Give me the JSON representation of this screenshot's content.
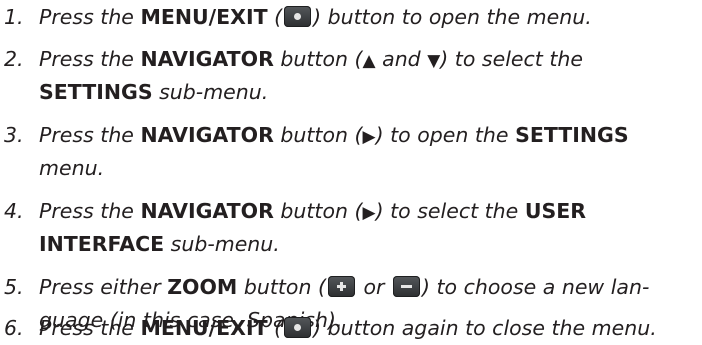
{
  "steps": [
    {
      "num": "1.",
      "t1": "Press the ",
      "b1": "MENU/EXIT",
      "t2": " (",
      "icon": "menu-exit-button-icon",
      "t3": ") button to open the menu."
    },
    {
      "num": "2.",
      "t1": "Press the ",
      "b1": "NAVIGATOR",
      "t2": " button (",
      "g1": "▲",
      "t3": " and ",
      "g2": "▼",
      "t4": ") to select the",
      "b2": "SETTINGS",
      "t5": " sub-menu."
    },
    {
      "num": "3.",
      "t1": "Press the ",
      "b1": "NAVIGATOR",
      "t2": " button (",
      "g1": "▶",
      "t3": ") to open the ",
      "b2": "SETTINGS",
      "t4": "menu."
    },
    {
      "num": "4.",
      "t1": "Press the ",
      "b1": "NAVIGATOR",
      "t2": " button (",
      "g1": "▶",
      "t3": ") to select the ",
      "b2": "USER",
      "b3": "INTERFACE",
      "t4": " sub-menu."
    },
    {
      "num": "5.",
      "t1": "Press either ",
      "b1": "ZOOM",
      "t2": " button (",
      "icon_plus": "zoom-plus-button-icon",
      "t3": " or ",
      "icon_minus": "zoom-minus-button-icon",
      "t4": ") to choose a new lan-",
      "t5": "guage (in this case, Spanish)."
    },
    {
      "num": "6.",
      "t1": "Press the ",
      "b1": "MENU/EXIT",
      "t2": " (",
      "icon": "menu-exit-button-icon",
      "t3": ") button again to close the menu."
    }
  ]
}
